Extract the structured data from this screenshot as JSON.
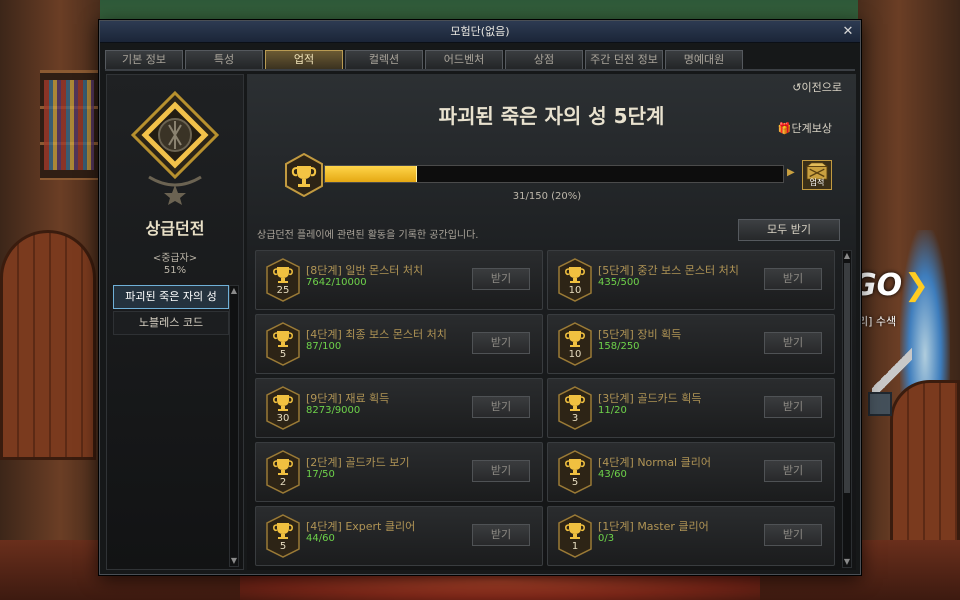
{
  "window": {
    "title": "모험단(없음)",
    "close_icon": "close-icon"
  },
  "tabs": [
    {
      "label": "기본 정보",
      "active": false
    },
    {
      "label": "특성",
      "active": false
    },
    {
      "label": "업적",
      "active": true
    },
    {
      "label": "컬렉션",
      "active": false
    },
    {
      "label": "어드벤처",
      "active": false
    },
    {
      "label": "상점",
      "active": false
    },
    {
      "label": "주간 던전 정보",
      "active": false
    },
    {
      "label": "명예대원",
      "active": false
    }
  ],
  "sidebar": {
    "title": "상급던전",
    "rank": "<중급자>",
    "percent": "51%",
    "items": [
      {
        "label": "파괴된 죽은 자의 성",
        "selected": true
      },
      {
        "label": "노블레스 코드",
        "selected": false
      }
    ]
  },
  "main": {
    "back_label": "이전으로",
    "stage_title": "파괴된 죽은 자의 성 5단계",
    "reward_label": "단계보상",
    "reward_box_label": "업적",
    "progress": {
      "current": 31,
      "total": 150,
      "text": "31/150 (20%)",
      "fraction": 0.2
    },
    "description": "상급던전 플레이에 관련된 활동을 기록한 공간입니다.",
    "claim_all_label": "모두 받기",
    "claim_label": "받기",
    "achievements": [
      {
        "level": "25",
        "title": "[8단계] 일반 몬스터 처치",
        "progress": "7642/10000"
      },
      {
        "level": "10",
        "title": "[5단계] 중간 보스 몬스터 처치",
        "progress": "435/500"
      },
      {
        "level": "5",
        "title": "[4단계] 최종 보스 몬스터 처치",
        "progress": "87/100"
      },
      {
        "level": "10",
        "title": "[5단계] 장비 획득",
        "progress": "158/250"
      },
      {
        "level": "30",
        "title": "[9단계] 재료 획득",
        "progress": "8273/9000"
      },
      {
        "level": "3",
        "title": "[3단계] 골드카드 획득",
        "progress": "11/20"
      },
      {
        "level": "2",
        "title": "[2단계] 골드카드 보기",
        "progress": "17/50"
      },
      {
        "level": "5",
        "title": "[4단계] Normal 클리어",
        "progress": "43/60"
      },
      {
        "level": "5",
        "title": "[4단계] Expert 클리어",
        "progress": "44/60"
      },
      {
        "level": "1",
        "title": "[1단계] Master 클리어",
        "progress": "0/3"
      }
    ]
  },
  "background": {
    "logo_text": "GO",
    "logo_sub": "리] 수색"
  },
  "colors": {
    "accent_gold": "#e5a813",
    "progress_green": "#6ed24a",
    "selected_border": "#6fb0d8",
    "titlebar": "#2d3b52"
  }
}
